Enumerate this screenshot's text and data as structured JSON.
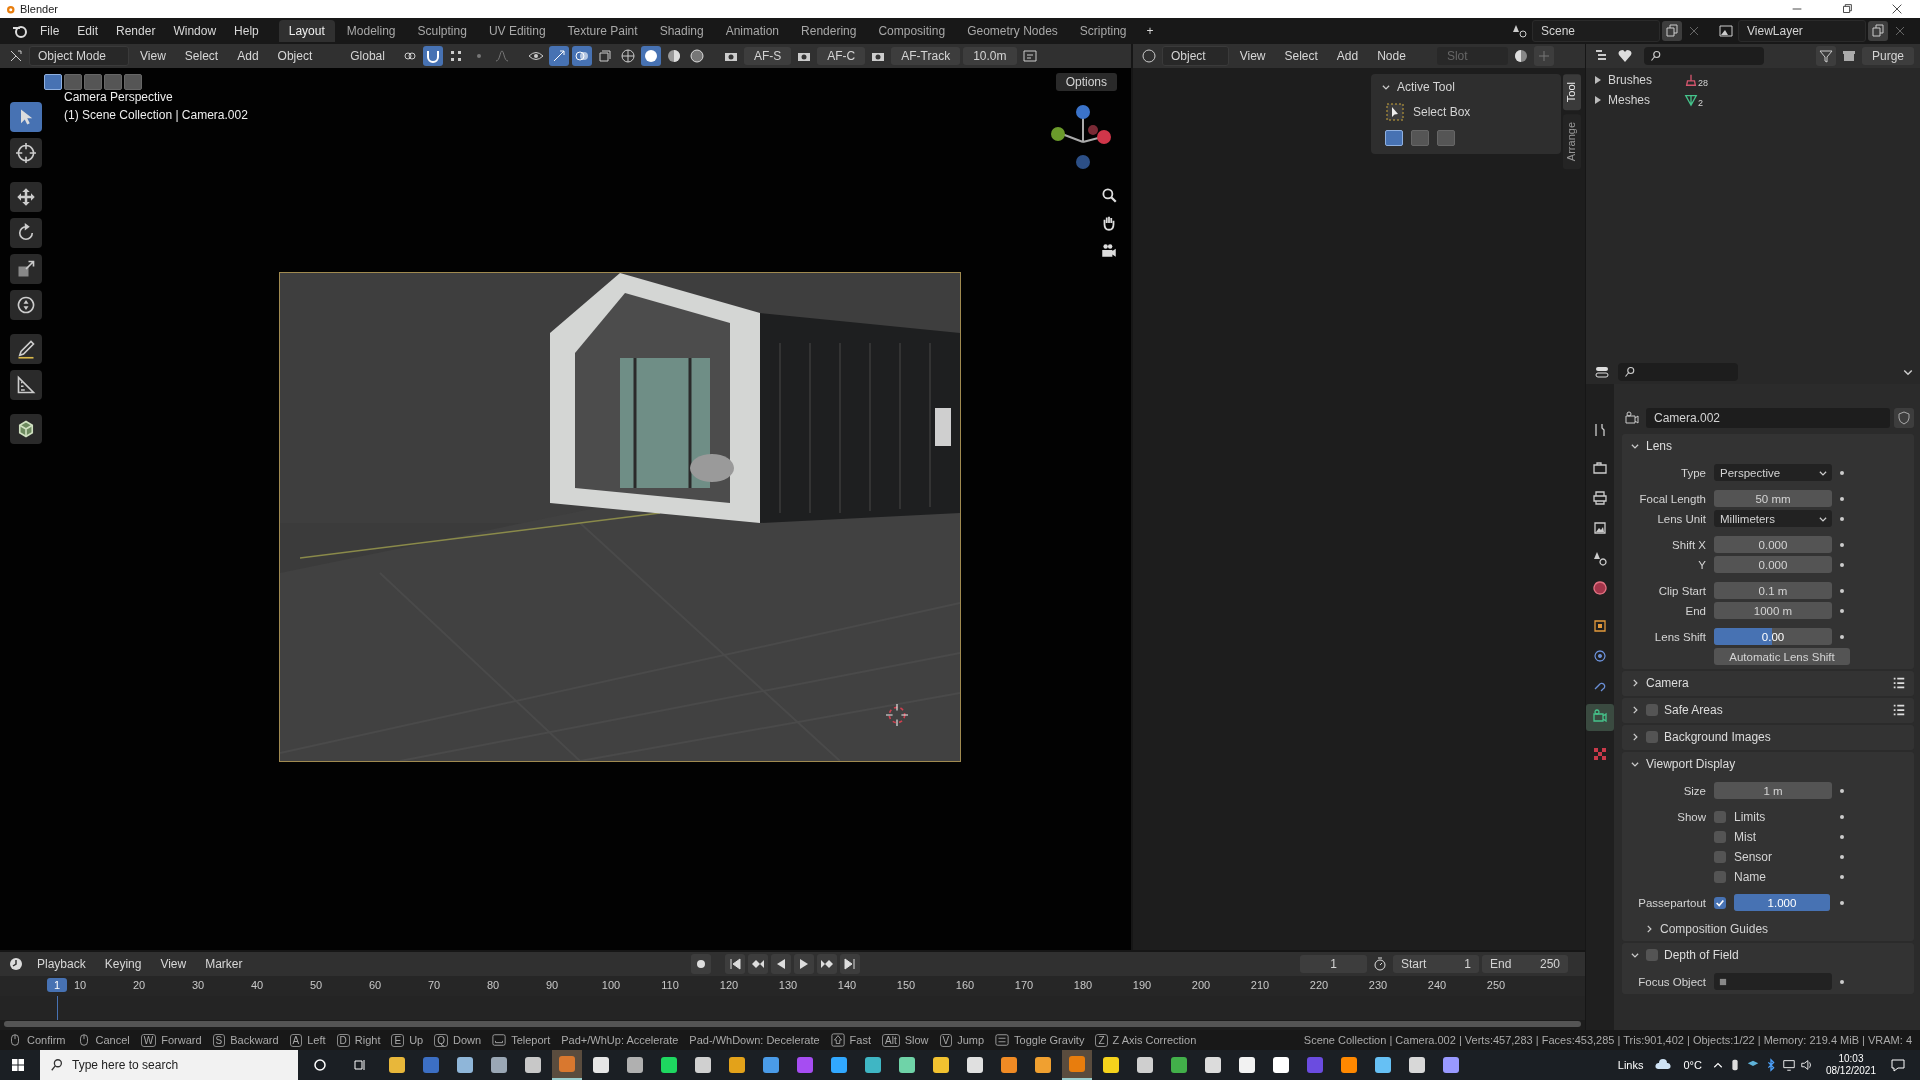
{
  "window": {
    "title": "Blender"
  },
  "menu": [
    "File",
    "Edit",
    "Render",
    "Window",
    "Help"
  ],
  "workspaces": [
    {
      "label": "Layout",
      "selected": true
    },
    {
      "label": "Modeling",
      "selected": false
    },
    {
      "label": "Sculpting",
      "selected": false
    },
    {
      "label": "UV Editing",
      "selected": false
    },
    {
      "label": "Texture Paint",
      "selected": false
    },
    {
      "label": "Shading",
      "selected": false
    },
    {
      "label": "Animation",
      "selected": false
    },
    {
      "label": "Rendering",
      "selected": false
    },
    {
      "label": "Compositing",
      "selected": false
    },
    {
      "label": "Geometry Nodes",
      "selected": false
    },
    {
      "label": "Scripting",
      "selected": false
    }
  ],
  "add_workspace": "+",
  "scene": "Scene",
  "view_layer": "ViewLayer",
  "viewport_header": {
    "mode": "Object Mode",
    "menus": [
      "View",
      "Select",
      "Add",
      "Object"
    ],
    "orientation": "Global",
    "af_buttons": [
      "AF-S",
      "AF-C",
      "AF-Track"
    ],
    "distance": "10.0m",
    "options": "Options"
  },
  "select_modes": [
    {
      "selected": true
    },
    {
      "selected": false
    },
    {
      "selected": false
    },
    {
      "selected": false
    },
    {
      "selected": false
    }
  ],
  "viewport": {
    "title": "Camera Perspective",
    "subtitle": "(1) Scene Collection | Camera.002",
    "tools": [
      {
        "kind": "select",
        "selected": true
      },
      {
        "kind": "cursor",
        "selected": false
      },
      {
        "kind": "move",
        "selected": false
      },
      {
        "kind": "rotate",
        "selected": false
      },
      {
        "kind": "scale",
        "selected": false
      },
      {
        "kind": "transform",
        "selected": false
      },
      {
        "kind": "annotate",
        "selected": false
      },
      {
        "kind": "measure",
        "selected": false
      },
      {
        "kind": "add_cube",
        "selected": false
      }
    ]
  },
  "node_header": {
    "object": "Object",
    "menus": [
      "View",
      "Select",
      "Add",
      "Node"
    ],
    "slot": "Slot"
  },
  "sidebar": {
    "panel": "Active Tool",
    "tool": "Select Box",
    "modes": [
      {
        "selected": true
      },
      {
        "selected": false
      },
      {
        "selected": false
      }
    ],
    "tabs": [
      {
        "label": "Tool",
        "selected": true
      },
      {
        "label": "Arrange",
        "selected": false
      }
    ]
  },
  "outliner": {
    "purge": "Purge",
    "items": [
      {
        "label": "Brushes",
        "count": "28",
        "kind": "brush"
      },
      {
        "label": "Meshes",
        "count": "2",
        "kind": "mesh"
      }
    ]
  },
  "properties": {
    "object": "Camera.002",
    "tabs": [
      {
        "kind": "tool",
        "selected": false
      },
      {
        "kind": "render",
        "selected": false
      },
      {
        "kind": "output",
        "selected": false
      },
      {
        "kind": "view_layer",
        "selected": false
      },
      {
        "kind": "scene",
        "selected": false
      },
      {
        "kind": "world",
        "selected": false
      },
      {
        "kind": "object",
        "selected": false
      },
      {
        "kind": "physics",
        "selected": false
      },
      {
        "kind": "constraints",
        "selected": false
      },
      {
        "kind": "data",
        "selected": true
      },
      {
        "kind": "texture",
        "selected": false
      }
    ],
    "panels": [
      {
        "title": "Lens",
        "expanded": true,
        "groups": [
          [
            {
              "kind": "dropdown",
              "label": "Type",
              "value": "Perspective"
            }
          ],
          [
            {
              "kind": "number",
              "label": "Focal Length",
              "value": "50 mm"
            },
            {
              "kind": "dropdown",
              "label": "Lens Unit",
              "value": "Millimeters"
            }
          ],
          [
            {
              "kind": "number",
              "label": "Shift X",
              "value": "0.000"
            },
            {
              "kind": "number",
              "label": "Y",
              "value": "0.000"
            }
          ],
          [
            {
              "kind": "number",
              "label": "Clip Start",
              "value": "0.1 m"
            },
            {
              "kind": "number",
              "label": "End",
              "value": "1000 m"
            }
          ],
          [
            {
              "kind": "slider",
              "label": "Lens Shift",
              "value": "0.00",
              "level": 0.49
            },
            {
              "kind": "button",
              "value": "Automatic Lens Shift"
            }
          ]
        ]
      },
      {
        "title": "Camera",
        "expanded": false,
        "presets": true
      },
      {
        "title": "Safe Areas",
        "expanded": false,
        "checked": false,
        "presets": true
      },
      {
        "title": "Background Images",
        "expanded": false,
        "checked": false
      },
      {
        "title": "Viewport Display",
        "expanded": true,
        "groups": [
          [
            {
              "kind": "number",
              "label": "Size",
              "value": "1 m"
            }
          ],
          [
            {
              "kind": "check",
              "label": "Show",
              "text": "Limits",
              "checked": false
            },
            {
              "kind": "check",
              "text": "Mist",
              "checked": false
            },
            {
              "kind": "check",
              "text": "Sensor",
              "checked": false
            },
            {
              "kind": "check",
              "text": "Name",
              "checked": false
            }
          ],
          [
            {
              "kind": "check_slider",
              "label": "Passepartout",
              "checked": true,
              "value": "1.000",
              "level": 1
            }
          ],
          [
            {
              "kind": "subpanel",
              "text": "Composition Guides",
              "expanded": false
            }
          ]
        ]
      },
      {
        "title": "Depth of Field",
        "expanded": true,
        "checked": false,
        "groups": [
          [
            {
              "kind": "object",
              "label": "Focus Object"
            }
          ]
        ]
      }
    ]
  },
  "timeline": {
    "menus": [
      "Playback",
      "Keying",
      "View",
      "Marker"
    ],
    "current_frame": "1",
    "start_label": "Start",
    "start": "1",
    "end_label": "End",
    "end": "250",
    "marker": "1",
    "ticks": [
      "10",
      "20",
      "30",
      "40",
      "50",
      "60",
      "70",
      "80",
      "90",
      "100",
      "110",
      "120",
      "130",
      "140",
      "150",
      "160",
      "170",
      "180",
      "190",
      "200",
      "210",
      "220",
      "230",
      "240",
      "250"
    ]
  },
  "status_bar": {
    "hints": [
      {
        "kind": "mouse",
        "text": "Confirm"
      },
      {
        "kind": "mouse",
        "text": "Cancel"
      },
      {
        "kind": "key",
        "key": "W",
        "text": "Forward"
      },
      {
        "kind": "key",
        "key": "S",
        "text": "Backward"
      },
      {
        "kind": "key",
        "key": "A",
        "text": "Left"
      },
      {
        "kind": "key",
        "key": "D",
        "text": "Right"
      },
      {
        "kind": "key",
        "key": "E",
        "text": "Up"
      },
      {
        "kind": "key",
        "key": "Q",
        "text": "Down"
      },
      {
        "kind": "space",
        "text": "Teleport"
      },
      {
        "kind": "plain",
        "text": "Pad+/WhUp: Accelerate"
      },
      {
        "kind": "plain",
        "text": "Pad-/WhDown: Decelerate"
      },
      {
        "kind": "shift",
        "text": "Fast"
      },
      {
        "kind": "key",
        "key": "Alt",
        "text": "Slow"
      },
      {
        "kind": "key",
        "key": "V",
        "text": "Jump"
      },
      {
        "kind": "tab",
        "text": "Toggle Gravity"
      },
      {
        "kind": "key",
        "key": "Z",
        "text": "Z Axis Correction"
      }
    ],
    "stats": "Scene Collection | Camera.002 | Verts:457,283 | Faces:453,285 | Tris:901,402 | Objects:1/22 | Memory: 219.4 MiB | VRAM: 4"
  },
  "taskbar": {
    "search": {
      "placeholder": "Type here to search"
    },
    "apps": [
      {
        "color": "#e8b73a",
        "selected": false
      },
      {
        "color": "#3c6fc4",
        "selected": false
      },
      {
        "color": "#8fb6d9",
        "selected": false
      },
      {
        "color": "#9aa7b5",
        "selected": false
      },
      {
        "color": "#c8c8c8",
        "selected": false
      },
      {
        "color": "#d9782f",
        "selected": true
      },
      {
        "color": "#e6e6e6",
        "selected": false
      },
      {
        "color": "#b0b0b0",
        "selected": false
      },
      {
        "color": "#1ed760",
        "selected": false
      },
      {
        "color": "#d0d0d0",
        "selected": false
      },
      {
        "color": "#e3a21a",
        "selected": false
      },
      {
        "color": "#4a9be8",
        "selected": false
      },
      {
        "color": "#a64df2",
        "selected": false
      },
      {
        "color": "#31a8ff",
        "selected": false
      },
      {
        "color": "#3fb6c4",
        "selected": false
      },
      {
        "color": "#6fd3a8",
        "selected": false
      },
      {
        "color": "#f2c230",
        "selected": false
      },
      {
        "color": "#e0e0e0",
        "selected": false
      },
      {
        "color": "#f08a24",
        "selected": false
      },
      {
        "color": "#f0a030",
        "selected": false
      },
      {
        "color": "#e87d0d",
        "selected": true
      },
      {
        "color": "#f6d31c",
        "selected": false
      },
      {
        "color": "#cfcfcf",
        "selected": false
      },
      {
        "color": "#42b04a",
        "selected": false
      },
      {
        "color": "#dcdcdc",
        "selected": false
      },
      {
        "color": "#f2f2f2",
        "selected": false
      },
      {
        "color": "#ffffff",
        "selected": false
      },
      {
        "color": "#6b4ce0",
        "selected": false
      },
      {
        "color": "#ff8800",
        "selected": false
      },
      {
        "color": "#66c0f4",
        "selected": false
      },
      {
        "color": "#d8d8d8",
        "selected": false
      },
      {
        "color": "#9999ff",
        "selected": false
      }
    ],
    "tray": {
      "links": "Links",
      "temperature": "0°C",
      "time": "10:03",
      "date": "08/12/2021"
    }
  }
}
